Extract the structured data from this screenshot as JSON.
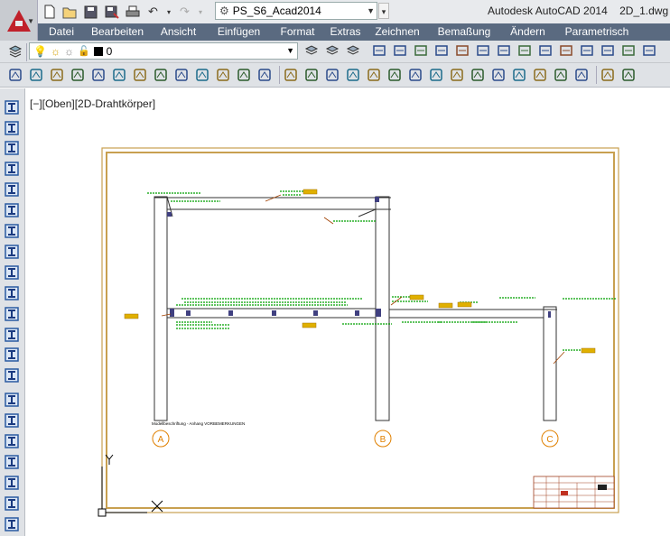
{
  "app": {
    "title": "Autodesk AutoCAD 2014",
    "filename": "2D_1.dwg"
  },
  "quick_access": {
    "workspace": "PS_S6_Acad2014",
    "icons": [
      "new-icon",
      "open-icon",
      "save-icon",
      "saveas-icon",
      "print-icon",
      "undo-icon",
      "redo-icon"
    ]
  },
  "menu": {
    "items": [
      "Datei",
      "Bearbeiten",
      "Ansicht",
      "Einfügen",
      "Format",
      "Extras",
      "Zeichnen",
      "Bemaßung",
      "Ändern",
      "Parametrisch"
    ]
  },
  "layer": {
    "current": "0"
  },
  "viewport": {
    "label": "[−][Oben][2D-Drahtkörper]"
  },
  "drawing": {
    "axis_labels": [
      "A",
      "B",
      "C"
    ],
    "caption": "Modellbeschriftung - Anhang VORBEMERKUNGEN",
    "colors": {
      "frame": "#c8a050",
      "lines": "#333333",
      "annotations": "#00a000",
      "tags": "#e0b000",
      "axis": "#e08000",
      "members": "#404080"
    }
  }
}
